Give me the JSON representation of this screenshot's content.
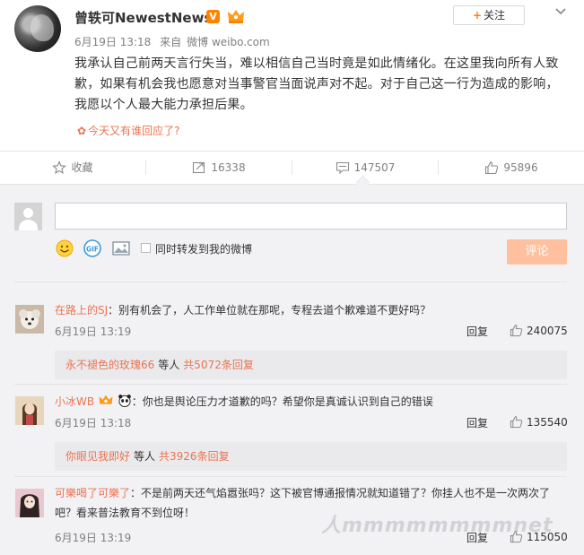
{
  "post": {
    "author": "曾轶可NewestNews",
    "verified_badge": "V",
    "date": "6月19日 13:18",
    "source_prefix": "来自",
    "source": "微博 weibo.com",
    "follow_label": "关注",
    "text": "我承认自己前两天言行失当，难以相信自己当时竟是如此情绪化。在这里我向所有人致歉，如果有机会我也愿意对当事警官当面说声对不起。对于自己这一行为造成的影响，我愿以个人最大能力承担后果。",
    "topic_link": "今天又有谁回应了?"
  },
  "actions": {
    "favorite": "收藏",
    "repost_count": "16338",
    "comment_count": "147507",
    "like_count": "95896"
  },
  "composer": {
    "placeholder": "",
    "repost_option": "同时转发到我的微博",
    "submit_label": "评论"
  },
  "comments": [
    {
      "nick": "在路上的SJ",
      "text": "：别有机会了，人工作单位就在那呢，专程去道个歉难道不更好吗？",
      "time": "6月19日 13:19",
      "reply": "回复",
      "likes": "240075",
      "sub_user": "永不褪色的玫瑰66",
      "sub_mid": "等人",
      "sub_count": "共5072条回复"
    },
    {
      "nick": "小冰WB",
      "text": "：你也是舆论压力才道歉的吗？希望你是真诚认识到自己的错误",
      "time": "6月19日 13:18",
      "reply": "回复",
      "likes": "135540",
      "sub_user": "你眼见我即好",
      "sub_mid": "等人",
      "sub_count": "共3926条回复"
    },
    {
      "nick": "可樂喝了可樂了",
      "text": "：不是前两天还气焰嚣张吗？这下被官博通报情况就知道错了？你挂人也不是一次两次了吧？看来普法教育不到位呀！",
      "time": "6月19日 13:19",
      "reply": "回复",
      "likes": "115050"
    }
  ],
  "watermark": "人mmmmmmmmnet",
  "colors": {
    "link": "#eb7350",
    "accent": "#ff8200",
    "comment_bg": "#f2f2f5",
    "submit_disabled": "#ffc09f"
  },
  "icons": [
    "more-chevron-icon",
    "star-icon",
    "repost-icon",
    "comment-icon",
    "thumbs-up-icon",
    "smiley-icon",
    "gif-icon",
    "image-icon",
    "panda-icon",
    "crown-icon",
    "flower-icon"
  ]
}
